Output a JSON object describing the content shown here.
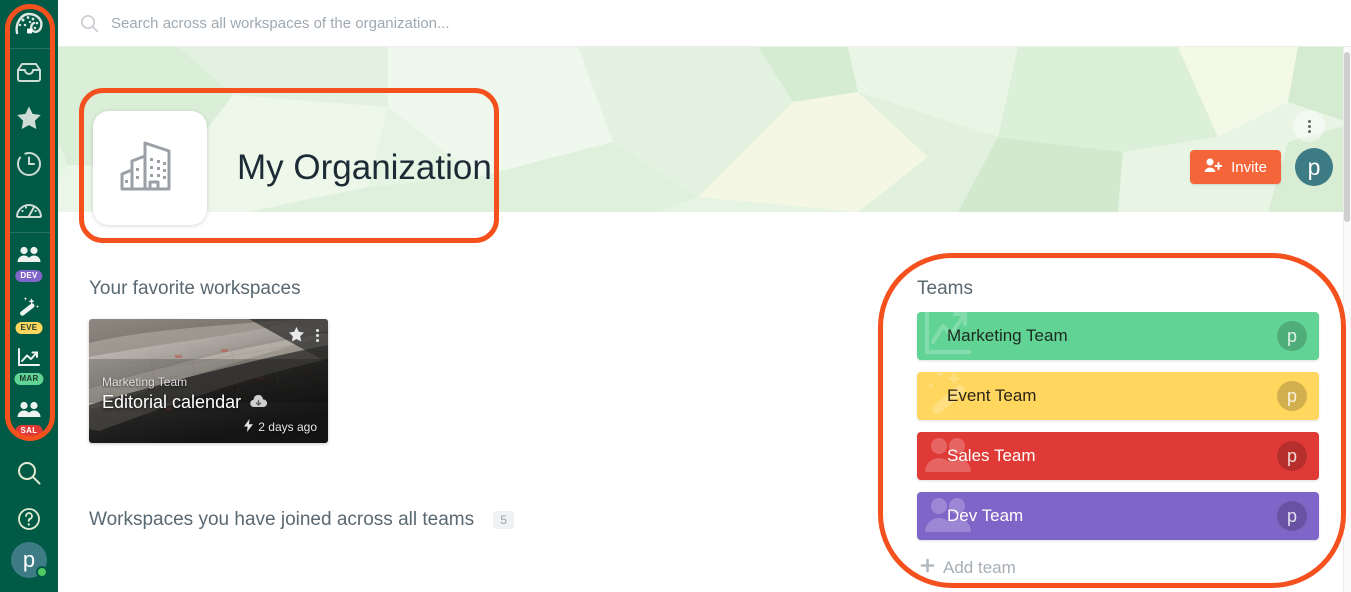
{
  "colors": {
    "sidebar_bg": "#005a46",
    "accent_orange": "#f4663a",
    "annotation": "#f4511e",
    "avatar_teal": "#3d7b85",
    "banner_bg": "#e9f6e8"
  },
  "search": {
    "placeholder": "Search across all workspaces of the organization...",
    "value": "",
    "icon": "search-icon"
  },
  "sidebar": {
    "logo": {
      "name": "app-logo-icon",
      "label": "Padlet"
    },
    "nav": [
      {
        "name": "inbox-icon",
        "label": "Inbox"
      },
      {
        "name": "star-icon",
        "label": "Favorites"
      },
      {
        "name": "clock-icon",
        "label": "Recents"
      },
      {
        "name": "gauge-icon",
        "label": "Dashboard"
      }
    ],
    "workspaces": [
      {
        "name": "people-icon",
        "badge": "DEV",
        "badge_color": "#8065c9",
        "badge_text_color": "#ffffff"
      },
      {
        "name": "magic-wand-icon",
        "badge": "EVE",
        "badge_color": "#ffd75e",
        "badge_text_color": "#1d3b2a"
      },
      {
        "name": "chart-icon",
        "badge": "MAR",
        "badge_color": "#61d395",
        "badge_text_color": "#1d3b2a"
      },
      {
        "name": "people-icon",
        "badge": "SAL",
        "badge_color": "#e03a36",
        "badge_text_color": "#ffffff"
      }
    ],
    "bottom": [
      {
        "name": "search-icon",
        "label": "Search"
      },
      {
        "name": "help-icon",
        "label": "Help"
      }
    ],
    "avatar": {
      "initial": "p",
      "status": "online"
    }
  },
  "banner": {
    "menu_icon": "more-vertical-icon",
    "org_logo_icon": "organization-building-icon",
    "org_title": "My Organization",
    "invite_label": "Invite",
    "invite_icon": "person-add-icon",
    "avatar_initial": "p"
  },
  "favorites": {
    "section_title": "Your favorite workspaces",
    "cards": [
      {
        "team": "Marketing Team",
        "name": "Editorial calendar",
        "timestamp": "2 days ago",
        "timestamp_icon": "bolt-icon",
        "star_icon": "star-icon",
        "menu_icon": "more-vertical-icon",
        "cloud_icon": "cloud-download-icon"
      }
    ]
  },
  "joined": {
    "section_title": "Workspaces you have joined across all teams",
    "count": "5"
  },
  "teams": {
    "title": "Teams",
    "add_label": "Add team",
    "add_icon": "plus-icon",
    "items": [
      {
        "label": "Marketing Team",
        "color": "#61d395",
        "text_color": "#1d2b20",
        "avatar": "p",
        "icon": "chart-icon"
      },
      {
        "label": "Event Team",
        "color": "#ffd75e",
        "text_color": "#2b2416",
        "avatar": "p",
        "icon": "magic-wand-icon"
      },
      {
        "label": "Sales Team",
        "color": "#e03a36",
        "text_color": "#ffffff",
        "avatar": "p",
        "icon": "people-icon"
      },
      {
        "label": "Dev Team",
        "color": "#8065c9",
        "text_color": "#ffffff",
        "avatar": "p",
        "icon": "people-icon"
      }
    ]
  }
}
